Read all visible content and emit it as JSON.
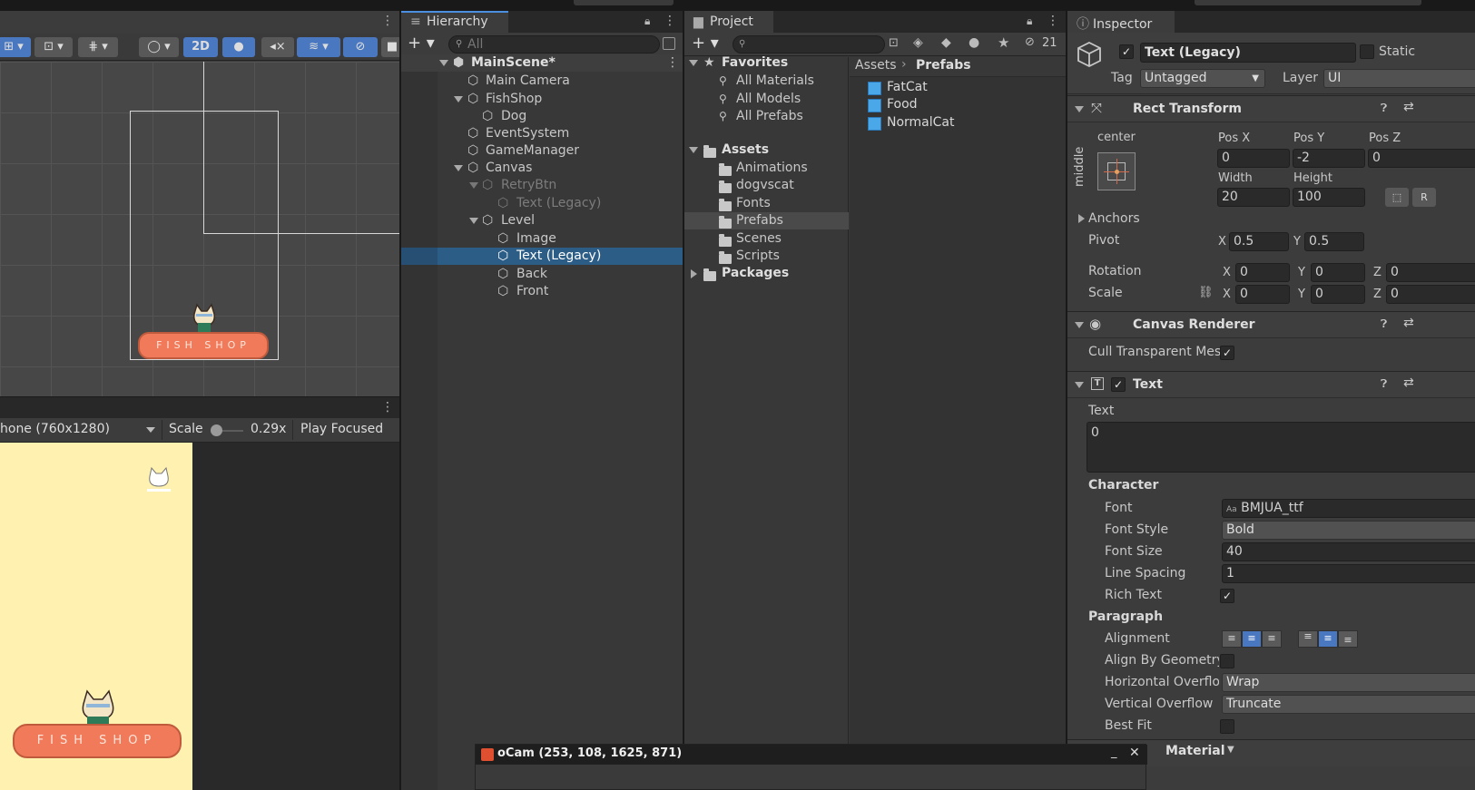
{
  "scene_toolbar": {
    "mode_2d": "2D"
  },
  "game_toolbar": {
    "resolution": "hone (760x1280)",
    "scale_label": "Scale",
    "scale_value": "0.29x",
    "play_focused": "Play Focused"
  },
  "fish_shop_sign": "FISH SHOP",
  "hierarchy": {
    "tab": "Hierarchy",
    "search_placeholder": "All",
    "items": [
      {
        "label": "MainScene*"
      },
      {
        "label": "Main Camera"
      },
      {
        "label": "FishShop"
      },
      {
        "label": "Dog"
      },
      {
        "label": "EventSystem"
      },
      {
        "label": "GameManager"
      },
      {
        "label": "Canvas"
      },
      {
        "label": "RetryBtn"
      },
      {
        "label": "Text (Legacy)"
      },
      {
        "label": "Level"
      },
      {
        "label": "Image"
      },
      {
        "label": "Text (Legacy)"
      },
      {
        "label": "Back"
      },
      {
        "label": "Front"
      }
    ]
  },
  "project": {
    "tab": "Project",
    "hidden_count": "21",
    "tree": {
      "favorites": "Favorites",
      "favorites_items": [
        "All Materials",
        "All Models",
        "All Prefabs"
      ],
      "assets": "Assets",
      "assets_items": [
        "Animations",
        "dogvscat",
        "Fonts",
        "Prefabs",
        "Scenes",
        "Scripts"
      ],
      "packages": "Packages"
    },
    "breadcrumb": [
      "Assets",
      "Prefabs"
    ],
    "files": [
      "FatCat",
      "Food",
      "NormalCat"
    ]
  },
  "inspector": {
    "tab": "Inspector",
    "object_name": "Text (Legacy)",
    "static_label": "Static",
    "tag_label": "Tag",
    "tag_value": "Untagged",
    "layer_label": "Layer",
    "layer_value": "UI",
    "rect_transform": {
      "title": "Rect Transform",
      "anchor_h": "center",
      "anchor_v": "middle",
      "pos_x_label": "Pos X",
      "pos_x": "0",
      "pos_y_label": "Pos Y",
      "pos_y": "-2",
      "pos_z_label": "Pos Z",
      "pos_z": "0",
      "width_label": "Width",
      "width": "20",
      "height_label": "Height",
      "height": "100",
      "anchors_label": "Anchors",
      "pivot_label": "Pivot",
      "pivot_x": "0.5",
      "pivot_y": "0.5",
      "rotation_label": "Rotation",
      "rot_x": "0",
      "rot_y": "0",
      "rot_z": "0",
      "scale_label": "Scale",
      "scale_x": "0",
      "scale_y": "0",
      "scale_z": "0",
      "x": "X",
      "y": "Y",
      "z": "Z"
    },
    "canvas_renderer": {
      "title": "Canvas Renderer",
      "cull_label": "Cull Transparent Mes"
    },
    "text_component": {
      "title": "Text",
      "text_label": "Text",
      "text_value": "0",
      "character_label": "Character",
      "font_label": "Font",
      "font_value": "BMJUA_ttf",
      "font_style_label": "Font Style",
      "font_style_value": "Bold",
      "font_size_label": "Font Size",
      "font_size_value": "40",
      "line_spacing_label": "Line Spacing",
      "line_spacing_value": "1",
      "rich_text_label": "Rich Text",
      "paragraph_label": "Paragraph",
      "alignment_label": "Alignment",
      "align_geometry_label": "Align By Geometry",
      "h_overflow_label": "Horizontal Overflo",
      "h_overflow_value": "Wrap",
      "v_overflow_label": "Vertical Overflow",
      "v_overflow_value": "Truncate",
      "best_fit_label": "Best Fit"
    },
    "material_label": "Material"
  },
  "ocam": {
    "title": "oCam (253, 108, 1625, 871)"
  }
}
